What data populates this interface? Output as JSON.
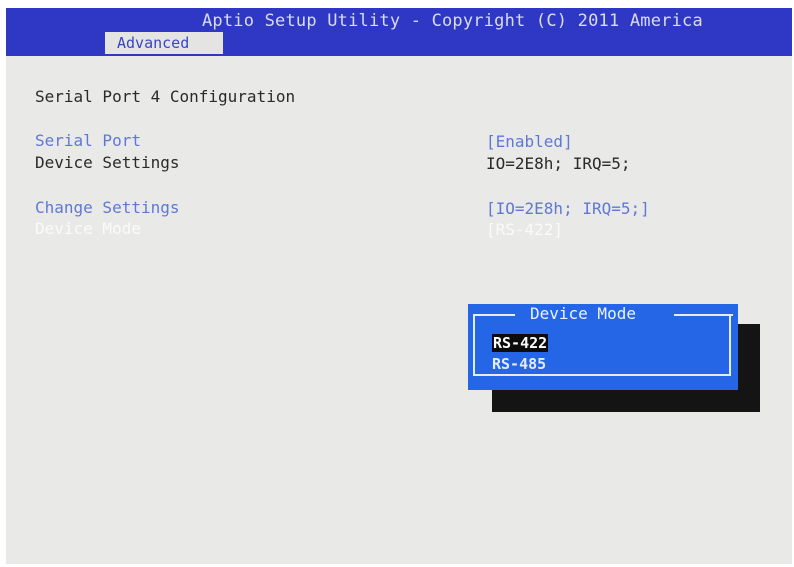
{
  "title_bar": {
    "text": "Aptio Setup Utility - Copyright (C) 2011 America",
    "active_tab": "Advanced"
  },
  "page": {
    "heading": "Serial Port 4 Configuration",
    "settings": [
      {
        "label": "Serial Port",
        "value": "[Enabled]"
      },
      {
        "label": "Device Settings",
        "value": "IO=2E8h; IRQ=5;"
      },
      {
        "label": "Change Settings",
        "value": "[IO=2E8h; IRQ=5;]"
      },
      {
        "label": "Device Mode",
        "value": "[RS-422]"
      }
    ]
  },
  "popup": {
    "title": "Device Mode",
    "options": [
      "RS-422",
      "RS-485"
    ],
    "selected": "RS-422"
  },
  "colors": {
    "title_bar_bg": "#2f38c4",
    "screen_bg": "#e9e9e7",
    "setting_blue": "#5f78d6",
    "popup_bg": "#2466e6",
    "highlight_bg": "#0c0c0c"
  }
}
